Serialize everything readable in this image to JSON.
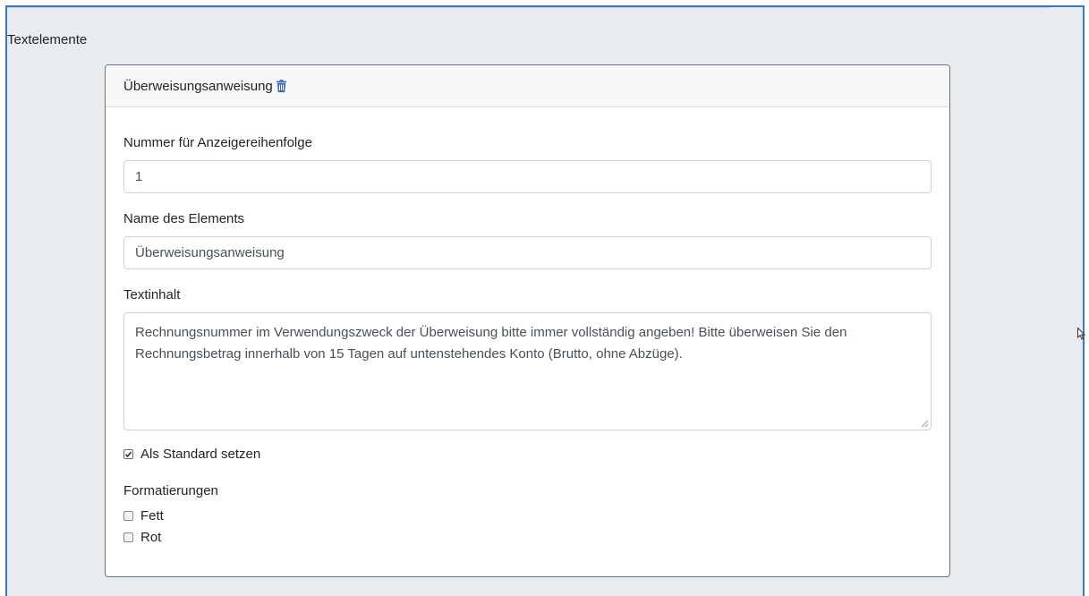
{
  "section": {
    "title": "Textelemente"
  },
  "card": {
    "title": "Überweisungsanweisung",
    "delete_icon": "trash-icon",
    "accent_color": "#1a73e8"
  },
  "fields": {
    "order_label": "Nummer für Anzeigereihenfolge",
    "order_value": "1",
    "name_label": "Name des Elements",
    "name_value": "Überweisungsanweisung",
    "content_label": "Textinhalt",
    "content_value": "Rechnungsnummer im Verwendungszweck der Überweisung bitte immer vollständig angeben! Bitte überweisen Sie den Rechnungsbetrag innerhalb von 15 Tagen auf untenstehendes Konto (Brutto, ohne Abzüge)."
  },
  "default_checkbox": {
    "label": "Als Standard setzen",
    "checked": true
  },
  "formatting": {
    "title": "Formatierungen",
    "options": [
      {
        "label": "Fett",
        "checked": false
      },
      {
        "label": "Rot",
        "checked": false
      }
    ]
  }
}
